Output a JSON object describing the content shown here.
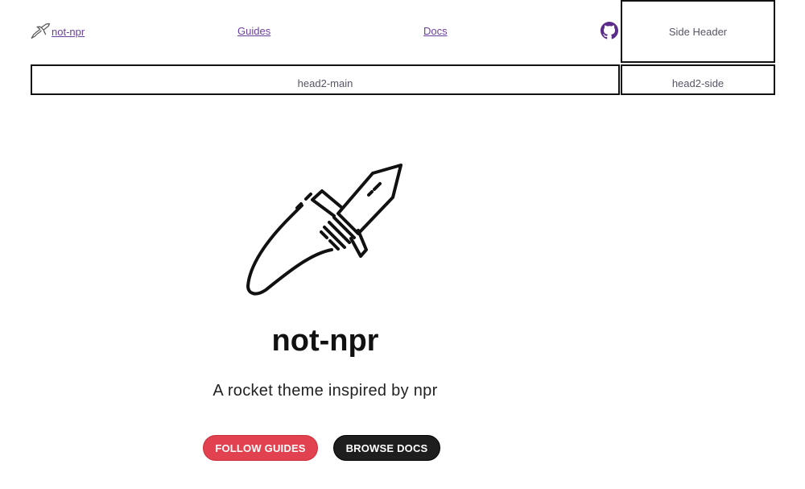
{
  "nav": {
    "brand_label": "not-npr",
    "guides_label": "Guides",
    "docs_label": "Docs",
    "github_icon": "github-icon",
    "brand_icon": "rocket-icon"
  },
  "side_header": {
    "label": "Side Header"
  },
  "head2": {
    "main_label": "head2-main",
    "side_label": "head2-side"
  },
  "hero": {
    "logo_icon": "rocket-icon",
    "title": "not-npr",
    "tagline": "A rocket theme inspired by npr",
    "follow_label": "FOLLOW GUIDES",
    "browse_label": "BROWSE DOCS"
  },
  "colors": {
    "link": "#6b3fa0",
    "follow_button": "#e2424f",
    "browse_button": "#1e1e1e"
  }
}
